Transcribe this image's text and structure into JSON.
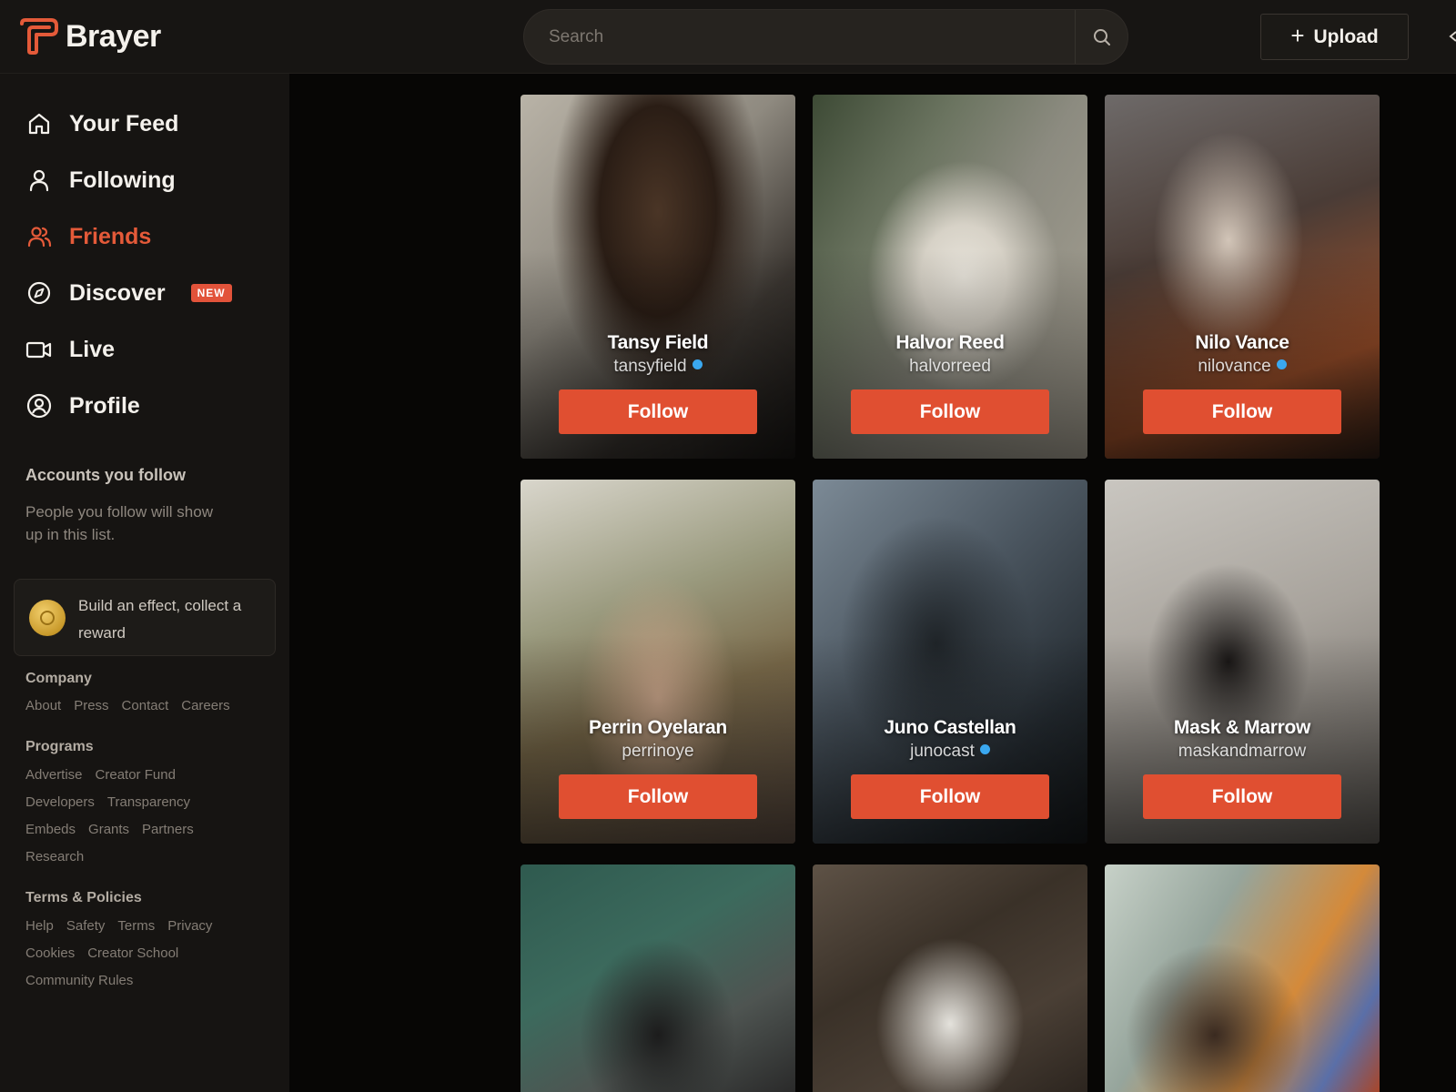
{
  "app": {
    "name": "Brayer",
    "brand_color": "#e45a39"
  },
  "header": {
    "search_placeholder": "Search",
    "upload_label": "Upload"
  },
  "nav": [
    {
      "label": "Your Feed",
      "icon": "home-icon",
      "active": false
    },
    {
      "label": "Following",
      "icon": "user-icon",
      "active": false
    },
    {
      "label": "Friends",
      "icon": "users-icon",
      "active": true
    },
    {
      "label": "Discover",
      "icon": "compass-icon",
      "active": false,
      "badge": "NEW"
    },
    {
      "label": "Live",
      "icon": "video-camera-icon",
      "active": false
    },
    {
      "label": "Profile",
      "icon": "profile-circle-icon",
      "active": false
    }
  ],
  "accounts": {
    "title": "Accounts you follow",
    "description": "People you follow will show up in this list."
  },
  "reward": {
    "text": "Build an effect, collect a reward",
    "icon": "coin-icon"
  },
  "footer": {
    "company": {
      "title": "Company",
      "links": [
        "About",
        "Press",
        "Contact",
        "Careers"
      ]
    },
    "programs": {
      "title": "Programs",
      "rows": [
        [
          "Advertise",
          "Creator Fund"
        ],
        [
          "Developers",
          "Transparency"
        ],
        [
          "Embeds",
          "Grants",
          "Partners"
        ],
        [
          "Research"
        ]
      ]
    },
    "terms": {
      "title": "Terms & Policies",
      "rows": [
        [
          "Help",
          "Safety",
          "Terms",
          "Privacy"
        ],
        [
          "Cookies",
          "Creator School"
        ],
        [
          "Community Rules"
        ]
      ]
    }
  },
  "creators": [
    {
      "name": "Tansy Field",
      "handle": "tansyfield",
      "verified": true,
      "follow_label": "Follow"
    },
    {
      "name": "Halvor Reed",
      "handle": "halvorreed",
      "verified": false,
      "follow_label": "Follow"
    },
    {
      "name": "Nilo Vance",
      "handle": "nilovance",
      "verified": true,
      "follow_label": "Follow"
    },
    {
      "name": "Perrin Oyelaran",
      "handle": "perrinoye",
      "verified": false,
      "follow_label": "Follow"
    },
    {
      "name": "Juno Castellan",
      "handle": "junocast",
      "verified": true,
      "follow_label": "Follow"
    },
    {
      "name": "Mask & Marrow",
      "handle": "maskandmarrow",
      "verified": false,
      "follow_label": "Follow"
    }
  ]
}
